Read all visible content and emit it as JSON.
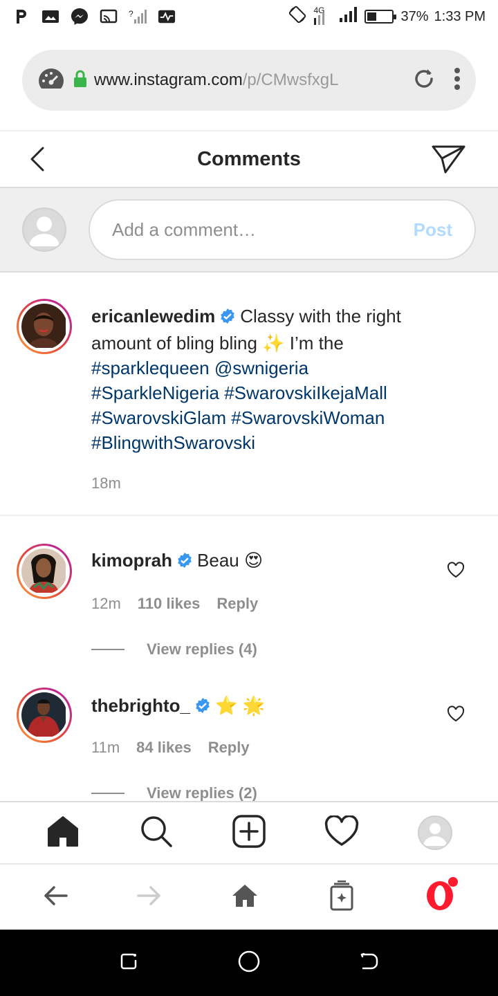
{
  "status_bar": {
    "network": "4G",
    "battery_percent": "37%",
    "time": "1:33 PM",
    "battery_level": 0.37
  },
  "browser": {
    "url_domain": "www.instagram.com",
    "url_path": "/p/CMwsfxgL"
  },
  "header": {
    "title": "Comments"
  },
  "add_comment": {
    "placeholder": "Add a comment…",
    "post_label": "Post"
  },
  "caption": {
    "username": "ericanlewedim",
    "text_1": "Classy with the right amount of bling bling",
    "emoji": "✨",
    "text_2": "I’m the",
    "hashtag_1": "#sparklequeen",
    "mention": "@swnigeria",
    "hashtag_2": "#SparkleNigeria",
    "hashtag_3": "#SwarovskiIkejaMall",
    "hashtag_4": "#SwarovskiGlam",
    "hashtag_5": "#SwarovskiWoman",
    "hashtag_6": "#BlingwithSwarovski",
    "time": "18m"
  },
  "comments": [
    {
      "username": "kimoprah",
      "text": "Beau",
      "emoji": "😍",
      "time": "12m",
      "likes": "110 likes",
      "reply_label": "Reply",
      "view_replies": "View replies (4)"
    },
    {
      "username": "thebrighto_",
      "text": "",
      "emoji": "⭐ 🌟",
      "time": "11m",
      "likes": "84 likes",
      "reply_label": "Reply",
      "view_replies": "View replies (2)"
    }
  ],
  "colors": {
    "link": "#00376b",
    "verified": "#3897f0",
    "post_disabled": "#b3dbff",
    "opera_red": "#ff1b2d"
  }
}
